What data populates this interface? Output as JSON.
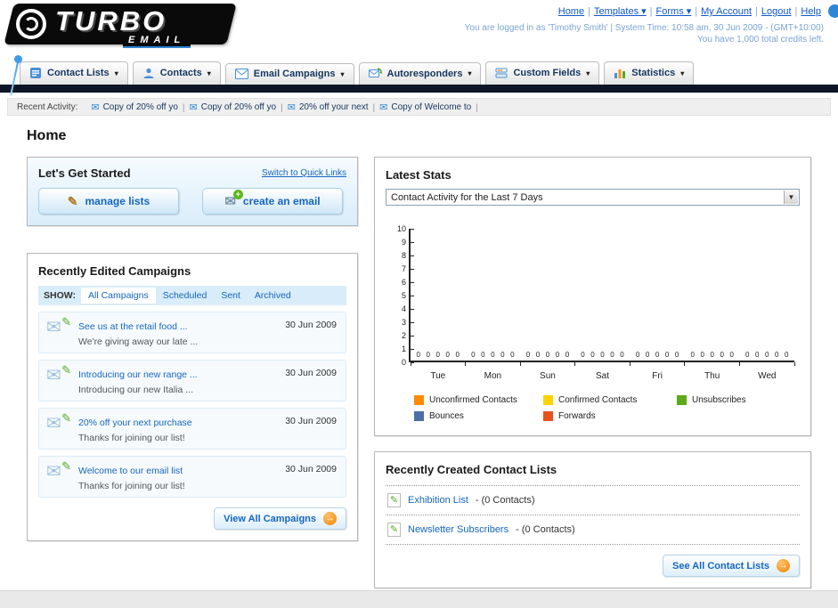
{
  "header": {
    "logo_title": "TURBO",
    "logo_subtitle": "EMAIL",
    "nav_links": [
      {
        "label": "Home"
      },
      {
        "label": "Templates",
        "dropdown": true
      },
      {
        "label": "Forms",
        "dropdown": true
      },
      {
        "label": "My Account"
      },
      {
        "label": "Logout"
      },
      {
        "label": "Help"
      }
    ],
    "login_info": "You are logged in as 'Timothy Smith' | System Time: 10:58 am, 30 Jun 2009 - (GMT+10:00)",
    "credits_info": "You have 1,000 total credits left."
  },
  "nav": {
    "tabs": [
      {
        "id": "contact-lists",
        "label": "Contact Lists",
        "icon": "contact-lists-icon"
      },
      {
        "id": "contacts",
        "label": "Contacts",
        "icon": "contacts-icon"
      },
      {
        "id": "email-campaigns",
        "label": "Email Campaigns",
        "icon": "email-campaigns-icon"
      },
      {
        "id": "autoresponders",
        "label": "Autoresponders",
        "icon": "autoresponders-icon"
      },
      {
        "id": "custom-fields",
        "label": "Custom Fields",
        "icon": "custom-fields-icon"
      },
      {
        "id": "statistics",
        "label": "Statistics",
        "icon": "statistics-icon"
      }
    ]
  },
  "recent_activity": {
    "label": "Recent Activity:",
    "items": [
      "Copy of 20% off yo",
      "Copy of 20% off yo",
      "20% off your next",
      "Copy of Welcome to"
    ]
  },
  "page_title": "Home",
  "get_started": {
    "title": "Let's Get Started",
    "switch_link": "Switch to Quick Links",
    "buttons": [
      {
        "label": "manage lists",
        "icon": "pencil-icon"
      },
      {
        "label": "create an email",
        "icon": "envelope-plus-icon"
      }
    ]
  },
  "campaigns": {
    "title": "Recently Edited Campaigns",
    "show_label": "SHOW:",
    "filters": [
      "All Campaigns",
      "Scheduled",
      "Sent",
      "Archived"
    ],
    "active_filter": "All Campaigns",
    "items": [
      {
        "title": "See us at the retail food ...",
        "subtitle": "We're giving away our late ...",
        "date": "30 Jun 2009"
      },
      {
        "title": "Introducing our new range ...",
        "subtitle": "Introducing our new Italia ...",
        "date": "30 Jun 2009"
      },
      {
        "title": "20% off your next purchase",
        "subtitle": "Thanks for joining our list!",
        "date": "30 Jun 2009"
      },
      {
        "title": "Welcome to our email list",
        "subtitle": "Thanks for joining our list!",
        "date": "30 Jun 2009"
      }
    ],
    "view_all_label": "View All Campaigns"
  },
  "stats": {
    "title": "Latest Stats",
    "period_selector": "Contact Activity for the Last 7 Days",
    "chart_data": {
      "type": "bar",
      "title": "Contact Activity for the Last 7 Days",
      "categories": [
        "Tue",
        "Mon",
        "Sun",
        "Sat",
        "Fri",
        "Thu",
        "Wed"
      ],
      "series": [
        {
          "name": "Unconfirmed Contacts",
          "color": "#ff8a00",
          "values": [
            0,
            0,
            0,
            0,
            0,
            0,
            0
          ]
        },
        {
          "name": "Confirmed Contacts",
          "color": "#ffd400",
          "values": [
            0,
            0,
            0,
            0,
            0,
            0,
            0
          ]
        },
        {
          "name": "Unsubscribes",
          "color": "#5ea918",
          "values": [
            0,
            0,
            0,
            0,
            0,
            0,
            0
          ]
        },
        {
          "name": "Bounces",
          "color": "#4d6fa8",
          "values": [
            0,
            0,
            0,
            0,
            0,
            0,
            0
          ]
        },
        {
          "name": "Forwards",
          "color": "#e8511c",
          "values": [
            0,
            0,
            0,
            0,
            0,
            0,
            0
          ]
        }
      ],
      "ylim": [
        0,
        10
      ],
      "yticks": [
        0,
        1,
        2,
        3,
        4,
        5,
        6,
        7,
        8,
        9,
        10
      ],
      "grid": false,
      "legend_position": "bottom"
    }
  },
  "contact_lists": {
    "title": "Recently Created Contact Lists",
    "items": [
      {
        "name": "Exhibition List",
        "detail": "- (0 Contacts)"
      },
      {
        "name": "Newsletter Subscribers",
        "detail": "- (0 Contacts)"
      }
    ],
    "see_all_label": "See All Contact Lists"
  },
  "colors": {
    "accent_orange": "#f7941d",
    "link_blue": "#1566c0",
    "dark_bar": "#0d1626"
  }
}
